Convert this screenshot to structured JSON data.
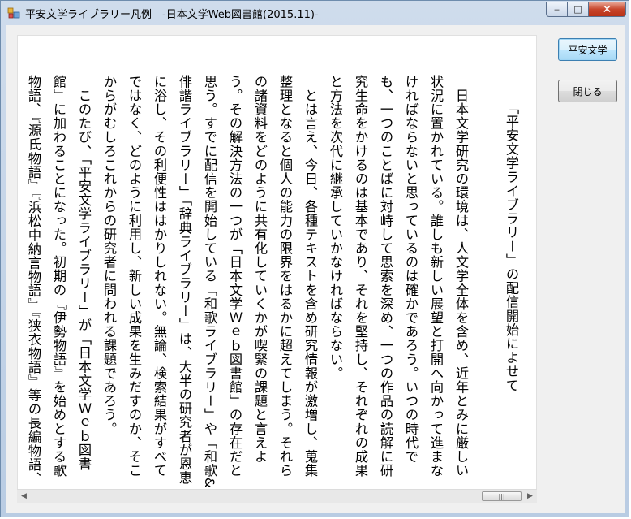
{
  "window": {
    "title": "平安文学ライブラリー凡例　-日本文学Web図書館(2015.11)-",
    "icon": "app-icon",
    "controls": {
      "minimize": "‒",
      "maximize": "□",
      "close": "✕"
    }
  },
  "document": {
    "title": "「平安文学ライブラリー」の配信開始によせて",
    "paragraphs": [
      "日本文学研究の環境は、人文学全体を含め、近年とみに厳しい状況に置かれている。誰しも新しい展望と打開へ向かって進まなければならないと思っているのは確かであろう。いつの時代でも、一つのことばに対峙して思索を深め、一つの作品の読解に研究生命をかけるのは基本であり、それを堅持し、それぞれの成果と方法を次代に継承していかなければならない。",
      "とは言え、今日、各種テキストを含め研究情報が激増し、蒐集整理となると個人の能力の限界をはるかに超えてしまう。それらの諸資料をどのように共有化していくかが喫緊の課題と言えよう。その解決方法の一つが「日本文学Ｗｅｂ図書館」の存在だと思う。すでに配信を開始している「和歌ライブラリー」や「和歌&俳諧ライブラリー」「辞典ライブラリー」は、大半の研究者が恩恵に浴し、その利便性ははかりしれない。無論、検索結果がすべてではなく、どのように利用し、新しい成果を生みだすのか、そこからがむしろこれからの研究者に問われる課題であろう。",
      "このたび、「平安文学ライブラリー」が「日本文学Ｗｅｂ図書館」に加わることになった。初期の『伊勢物語』を始めとする歌物語、『源氏物語』『浜松中納言物語』『狭衣物語』等の長編物語、『土佐日記』『枕草子』等の日記・随筆作品を厳密な本文校"
    ]
  },
  "buttons": {
    "heian": "平安文学",
    "close": "閉じる"
  },
  "scrollbar": {
    "left_arrow": "◀",
    "right_arrow": "▶",
    "thumb_grip": "|||"
  }
}
